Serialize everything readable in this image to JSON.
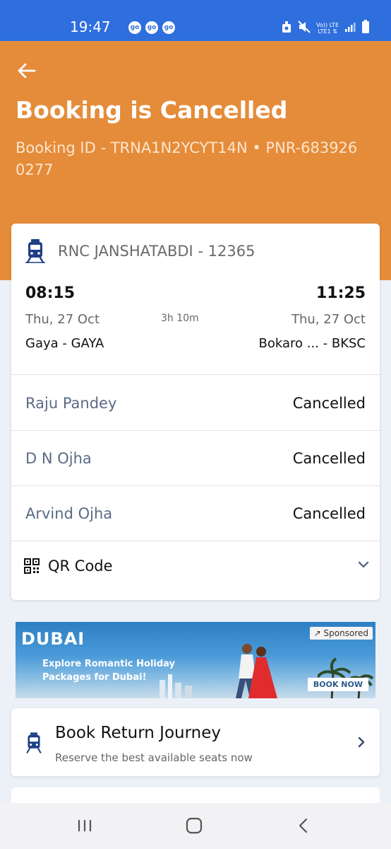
{
  "status_bar": {
    "time": "19:47",
    "badges": [
      "go",
      "go",
      "go"
    ],
    "network_top": "Vo)) LTE",
    "network_bottom": "LTE1 ⇅",
    "accent_color": "#2f6fdd"
  },
  "header": {
    "title": "Booking is Cancelled",
    "subtitle": "Booking ID - TRNA1N2YCYT14N • PNR-6839260277",
    "background_color": "#e58c3a"
  },
  "journey": {
    "train": "RNC JANSHATABDI - 12365",
    "departure": {
      "time": "08:15",
      "date": "Thu, 27 Oct",
      "station": "Gaya - GAYA"
    },
    "arrival": {
      "time": "11:25",
      "date": "Thu, 27 Oct",
      "station": "Bokaro ... - BKSC"
    },
    "duration": "3h 10m"
  },
  "passengers": [
    {
      "name": "Raju Pandey",
      "status": "Cancelled"
    },
    {
      "name": "D N Ojha",
      "status": "Cancelled"
    },
    {
      "name": "Arvind  Ojha",
      "status": "Cancelled"
    }
  ],
  "qr": {
    "label": "QR Code"
  },
  "ad": {
    "brand": "DUBAI",
    "headline": "Explore Romantic Holiday Packages for Dubai!",
    "sponsored": "Sponsored",
    "cta": "BOOK NOW"
  },
  "return_journey": {
    "title": "Book Return Journey",
    "subtitle": "Reserve the best available seats now"
  },
  "icons": [
    "back-arrow-icon",
    "train-icon",
    "qr-code-icon",
    "chevron-down-icon",
    "chevron-right-icon",
    "recents-icon",
    "home-icon",
    "back-nav-icon"
  ]
}
